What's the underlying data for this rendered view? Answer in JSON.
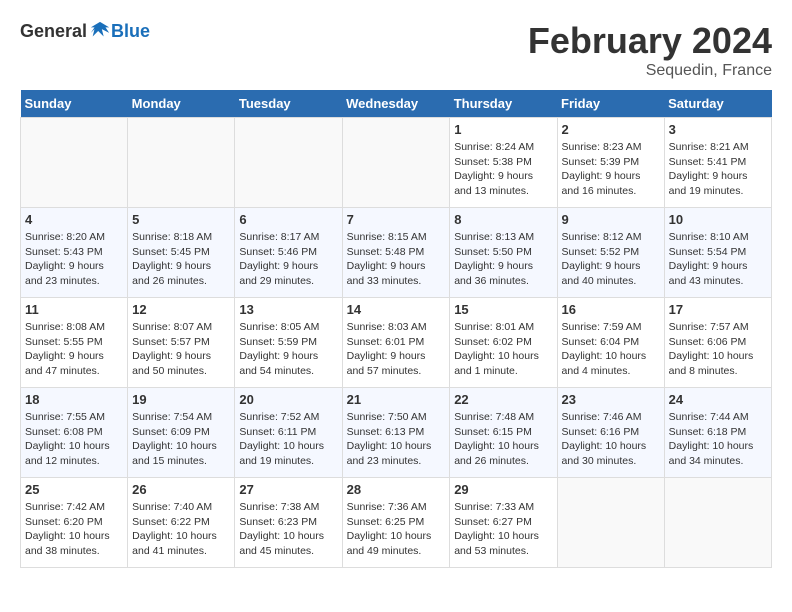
{
  "header": {
    "logo_general": "General",
    "logo_blue": "Blue",
    "month_year": "February 2024",
    "location": "Sequedin, France"
  },
  "weekdays": [
    "Sunday",
    "Monday",
    "Tuesday",
    "Wednesday",
    "Thursday",
    "Friday",
    "Saturday"
  ],
  "weeks": [
    [
      {
        "day": "",
        "info": ""
      },
      {
        "day": "",
        "info": ""
      },
      {
        "day": "",
        "info": ""
      },
      {
        "day": "",
        "info": ""
      },
      {
        "day": "1",
        "info": "Sunrise: 8:24 AM\nSunset: 5:38 PM\nDaylight: 9 hours\nand 13 minutes."
      },
      {
        "day": "2",
        "info": "Sunrise: 8:23 AM\nSunset: 5:39 PM\nDaylight: 9 hours\nand 16 minutes."
      },
      {
        "day": "3",
        "info": "Sunrise: 8:21 AM\nSunset: 5:41 PM\nDaylight: 9 hours\nand 19 minutes."
      }
    ],
    [
      {
        "day": "4",
        "info": "Sunrise: 8:20 AM\nSunset: 5:43 PM\nDaylight: 9 hours\nand 23 minutes."
      },
      {
        "day": "5",
        "info": "Sunrise: 8:18 AM\nSunset: 5:45 PM\nDaylight: 9 hours\nand 26 minutes."
      },
      {
        "day": "6",
        "info": "Sunrise: 8:17 AM\nSunset: 5:46 PM\nDaylight: 9 hours\nand 29 minutes."
      },
      {
        "day": "7",
        "info": "Sunrise: 8:15 AM\nSunset: 5:48 PM\nDaylight: 9 hours\nand 33 minutes."
      },
      {
        "day": "8",
        "info": "Sunrise: 8:13 AM\nSunset: 5:50 PM\nDaylight: 9 hours\nand 36 minutes."
      },
      {
        "day": "9",
        "info": "Sunrise: 8:12 AM\nSunset: 5:52 PM\nDaylight: 9 hours\nand 40 minutes."
      },
      {
        "day": "10",
        "info": "Sunrise: 8:10 AM\nSunset: 5:54 PM\nDaylight: 9 hours\nand 43 minutes."
      }
    ],
    [
      {
        "day": "11",
        "info": "Sunrise: 8:08 AM\nSunset: 5:55 PM\nDaylight: 9 hours\nand 47 minutes."
      },
      {
        "day": "12",
        "info": "Sunrise: 8:07 AM\nSunset: 5:57 PM\nDaylight: 9 hours\nand 50 minutes."
      },
      {
        "day": "13",
        "info": "Sunrise: 8:05 AM\nSunset: 5:59 PM\nDaylight: 9 hours\nand 54 minutes."
      },
      {
        "day": "14",
        "info": "Sunrise: 8:03 AM\nSunset: 6:01 PM\nDaylight: 9 hours\nand 57 minutes."
      },
      {
        "day": "15",
        "info": "Sunrise: 8:01 AM\nSunset: 6:02 PM\nDaylight: 10 hours\nand 1 minute."
      },
      {
        "day": "16",
        "info": "Sunrise: 7:59 AM\nSunset: 6:04 PM\nDaylight: 10 hours\nand 4 minutes."
      },
      {
        "day": "17",
        "info": "Sunrise: 7:57 AM\nSunset: 6:06 PM\nDaylight: 10 hours\nand 8 minutes."
      }
    ],
    [
      {
        "day": "18",
        "info": "Sunrise: 7:55 AM\nSunset: 6:08 PM\nDaylight: 10 hours\nand 12 minutes."
      },
      {
        "day": "19",
        "info": "Sunrise: 7:54 AM\nSunset: 6:09 PM\nDaylight: 10 hours\nand 15 minutes."
      },
      {
        "day": "20",
        "info": "Sunrise: 7:52 AM\nSunset: 6:11 PM\nDaylight: 10 hours\nand 19 minutes."
      },
      {
        "day": "21",
        "info": "Sunrise: 7:50 AM\nSunset: 6:13 PM\nDaylight: 10 hours\nand 23 minutes."
      },
      {
        "day": "22",
        "info": "Sunrise: 7:48 AM\nSunset: 6:15 PM\nDaylight: 10 hours\nand 26 minutes."
      },
      {
        "day": "23",
        "info": "Sunrise: 7:46 AM\nSunset: 6:16 PM\nDaylight: 10 hours\nand 30 minutes."
      },
      {
        "day": "24",
        "info": "Sunrise: 7:44 AM\nSunset: 6:18 PM\nDaylight: 10 hours\nand 34 minutes."
      }
    ],
    [
      {
        "day": "25",
        "info": "Sunrise: 7:42 AM\nSunset: 6:20 PM\nDaylight: 10 hours\nand 38 minutes."
      },
      {
        "day": "26",
        "info": "Sunrise: 7:40 AM\nSunset: 6:22 PM\nDaylight: 10 hours\nand 41 minutes."
      },
      {
        "day": "27",
        "info": "Sunrise: 7:38 AM\nSunset: 6:23 PM\nDaylight: 10 hours\nand 45 minutes."
      },
      {
        "day": "28",
        "info": "Sunrise: 7:36 AM\nSunset: 6:25 PM\nDaylight: 10 hours\nand 49 minutes."
      },
      {
        "day": "29",
        "info": "Sunrise: 7:33 AM\nSunset: 6:27 PM\nDaylight: 10 hours\nand 53 minutes."
      },
      {
        "day": "",
        "info": ""
      },
      {
        "day": "",
        "info": ""
      }
    ]
  ]
}
